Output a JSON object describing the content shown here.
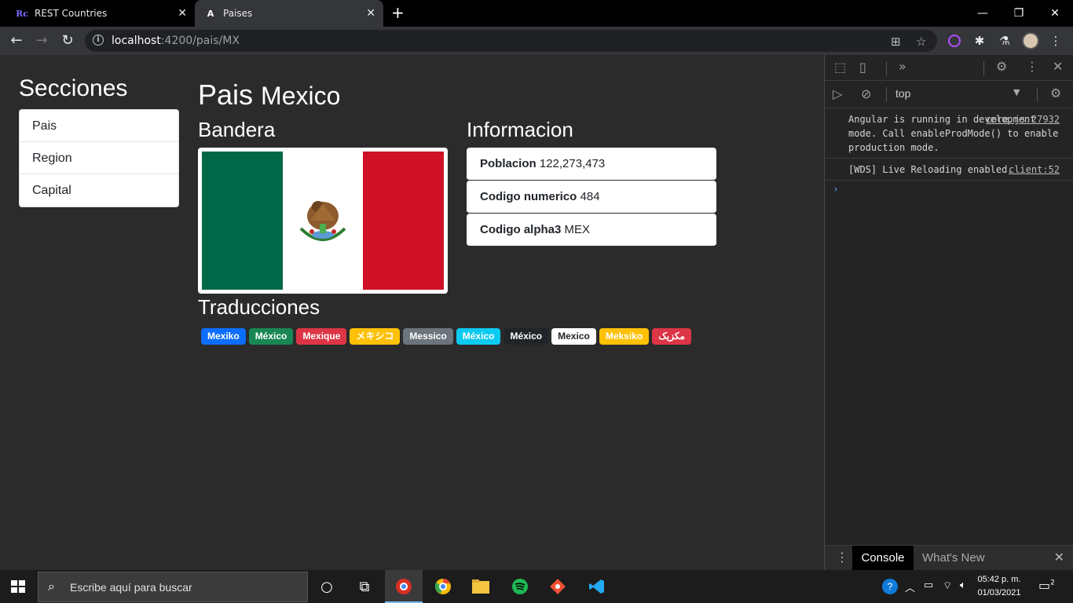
{
  "browser": {
    "tabs": [
      {
        "icon": "Rc",
        "title": "REST Countries",
        "active": false
      },
      {
        "icon": "A",
        "title": "Paises",
        "active": true
      }
    ],
    "url_host": "localhost",
    "url_rest": ":4200/pais/MX"
  },
  "sidebar": {
    "title": "Secciones",
    "items": [
      "Pais",
      "Region",
      "Capital"
    ]
  },
  "main": {
    "title_prefix": "Pais",
    "country_name": "Mexico",
    "flag_heading": "Bandera",
    "info_heading": "Informacion",
    "info": [
      {
        "label": "Poblacion",
        "value": "122,273,473"
      },
      {
        "label": "Codigo numerico",
        "value": "484"
      },
      {
        "label": "Codigo alpha3",
        "value": "MEX"
      }
    ],
    "translations_heading": "Traducciones",
    "translations": [
      {
        "text": "Mexiko",
        "color": "#0d6efd",
        "fg": "#ffffff"
      },
      {
        "text": "México",
        "color": "#198754",
        "fg": "#ffffff"
      },
      {
        "text": "Mexique",
        "color": "#dc3545",
        "fg": "#ffffff"
      },
      {
        "text": "メキシコ",
        "color": "#ffc107",
        "fg": "#ffffff"
      },
      {
        "text": "Messico",
        "color": "#6c757d",
        "fg": "#ffffff"
      },
      {
        "text": "México",
        "color": "#0dcaf0",
        "fg": "#ffffff"
      },
      {
        "text": "México",
        "color": "#212529",
        "fg": "#ffffff"
      },
      {
        "text": "Mexico",
        "color": "#ffffff",
        "fg": "#212529"
      },
      {
        "text": "Meksiko",
        "color": "#ffc107",
        "fg": "#ffffff"
      },
      {
        "text": "مکزیک",
        "color": "#dc3545",
        "fg": "#ffffff"
      }
    ]
  },
  "devtools": {
    "context": "top",
    "messages": [
      {
        "text": "Angular is running in development mode. Call enableProdMode() to enable production mode.",
        "source": "core.js:27932"
      },
      {
        "text": "[WDS] Live Reloading enabled.",
        "source": "client:52"
      }
    ],
    "drawer_tabs": [
      "Console",
      "What's New"
    ]
  },
  "taskbar": {
    "search_placeholder": "Escribe aquí para buscar",
    "time": "05:42 p. m.",
    "date": "01/03/2021",
    "notifications": "2"
  }
}
